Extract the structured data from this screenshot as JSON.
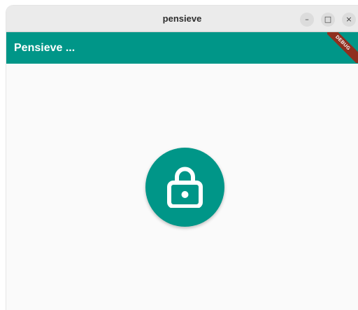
{
  "window": {
    "title": "pensieve",
    "controls": {
      "minimize": "–",
      "maximize": "□",
      "close": "×"
    }
  },
  "appbar": {
    "title": "Pensieve ...",
    "debug_banner": "DEBUG",
    "color": "#009688"
  },
  "main": {
    "lock_button": {
      "icon": "lock-icon",
      "color": "#009688"
    }
  }
}
